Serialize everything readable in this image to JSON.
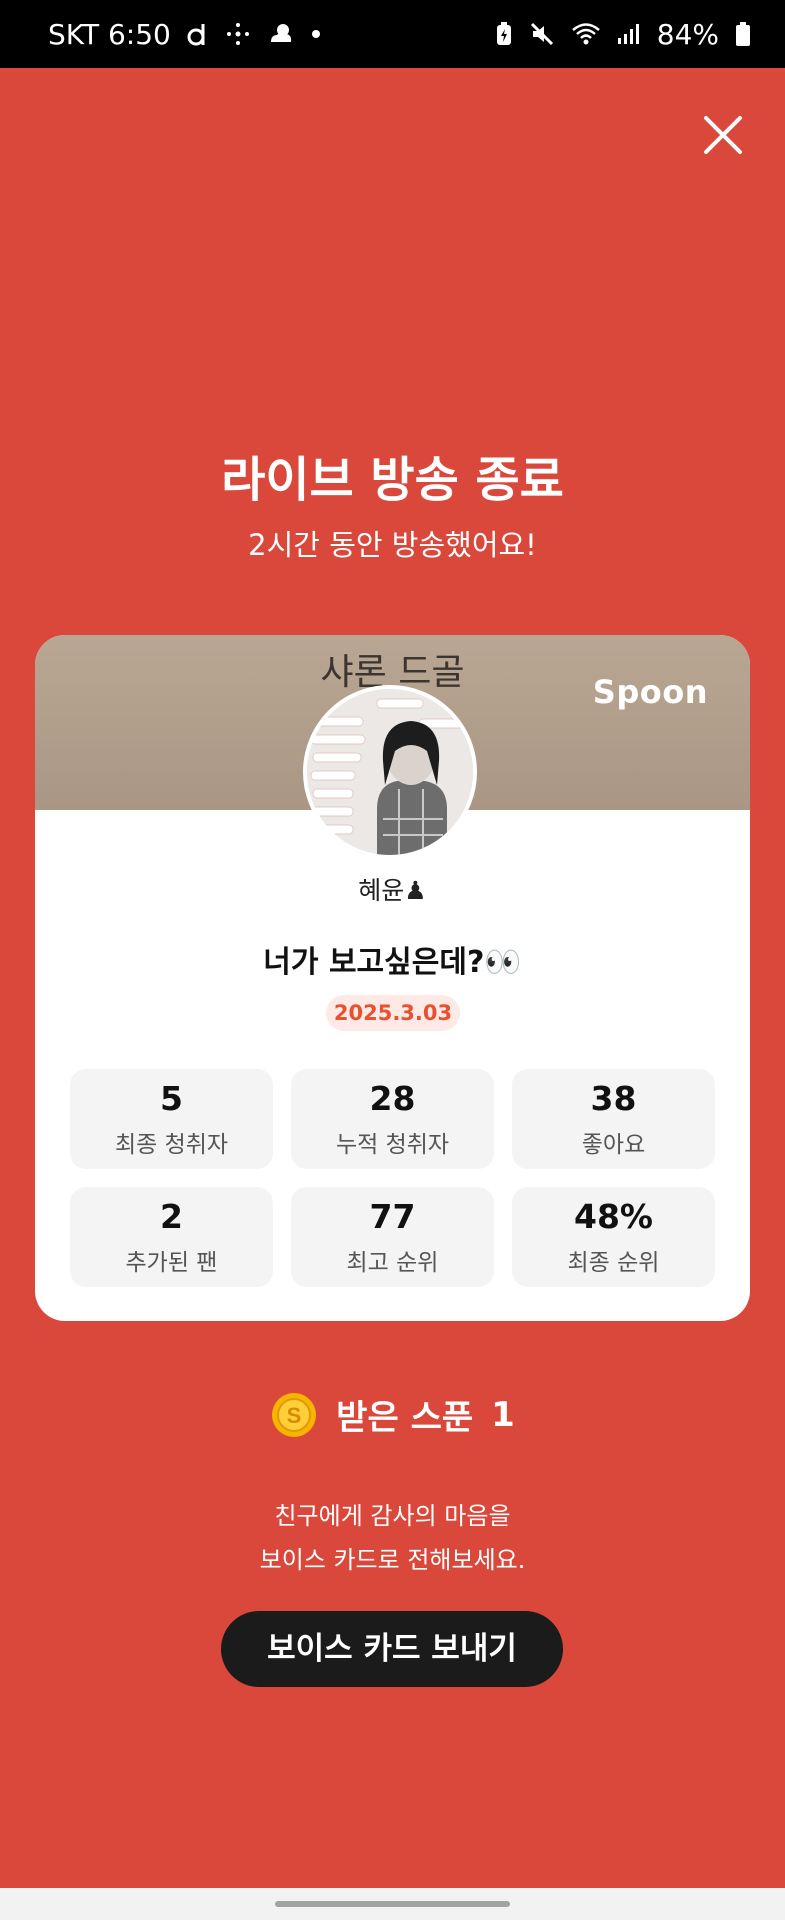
{
  "status_bar": {
    "carrier_time": "SKT 6:50",
    "battery": "84%",
    "icons_left": [
      "d-app-icon",
      "sparkle-icon",
      "weather-icon",
      "dot-icon"
    ],
    "icons_right": [
      "battery-saver-icon",
      "mute-icon",
      "wifi-icon",
      "signal-icon",
      "battery-icon"
    ]
  },
  "header": {
    "title": "라이브 방송 종료",
    "subtitle": "2시간 동안 방송했어요!"
  },
  "card": {
    "banner_text": "샤론 드골",
    "brand": "Spoon",
    "host_name": "혜윤♟",
    "live_title": "너가 보고싶은데?👀",
    "date": "2025.3.03",
    "stats": [
      {
        "value": "5",
        "label": "최종 청취자"
      },
      {
        "value": "28",
        "label": "누적 청취자"
      },
      {
        "value": "38",
        "label": "좋아요"
      },
      {
        "value": "2",
        "label": "추가된 팬"
      },
      {
        "value": "77",
        "label": "최고 순위"
      },
      {
        "value": "48%",
        "label": "최종 순위"
      }
    ]
  },
  "spoons": {
    "coin_glyph": "S",
    "label": "받은 스푼",
    "count": "1"
  },
  "message": {
    "line1": "친구에게 감사의 마음을",
    "line2": "보이스 카드로 전해보세요."
  },
  "send_button": "보이스 카드 보내기",
  "colors": {
    "background": "#d9483b",
    "accent": "#e8502e",
    "button": "#1b1b1b"
  }
}
